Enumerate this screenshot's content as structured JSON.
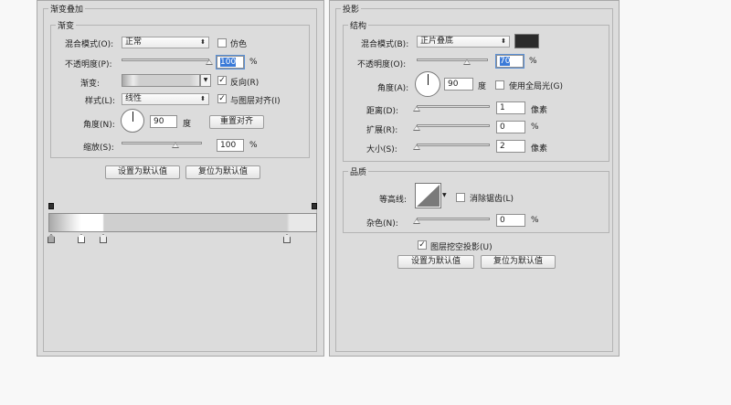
{
  "left_panel": {
    "title": "渐变叠加",
    "group_title": "渐变",
    "blend_mode": {
      "label": "混合模式(O):",
      "value": "正常"
    },
    "dither": {
      "label": "仿色",
      "checked": false
    },
    "opacity": {
      "label": "不透明度(P):",
      "value": "100",
      "unit": "%",
      "level": 100
    },
    "gradient": {
      "label": "渐变:"
    },
    "reverse": {
      "label": "反向(R)",
      "checked": true
    },
    "style": {
      "label": "样式(L):",
      "value": "线性"
    },
    "align_layer": {
      "label": "与图层对齐(I)",
      "checked": true
    },
    "angle": {
      "label": "角度(N):",
      "value": "90",
      "unit": "度"
    },
    "reset_align": "重置对齐",
    "scale": {
      "label": "缩放(S):",
      "value": "100",
      "unit": "%",
      "level": 67
    },
    "set_default": "设置为默认值",
    "reset_default": "复位为默认值",
    "gradient_colors": [
      "#a8a8a8",
      "#ececec",
      "#ffffff",
      "#cfcfcf",
      "#cfcfcf",
      "#e8e8e8"
    ]
  },
  "right_panel": {
    "title": "投影",
    "structure_title": "结构",
    "blend_mode": {
      "label": "混合模式(B):",
      "value": "正片叠底",
      "color": "#2b2b2b"
    },
    "opacity": {
      "label": "不透明度(O):",
      "value": "70",
      "unit": "%",
      "level": 70
    },
    "angle": {
      "label": "角度(A):",
      "value": "90",
      "unit": "度"
    },
    "global_light": {
      "label": "使用全局光(G)",
      "checked": false
    },
    "distance": {
      "label": "距离(D):",
      "value": "1",
      "unit": "像素"
    },
    "spread": {
      "label": "扩展(R):",
      "value": "0",
      "unit": "%"
    },
    "size": {
      "label": "大小(S):",
      "value": "2",
      "unit": "像素"
    },
    "quality_title": "品质",
    "contour": {
      "label": "等高线:"
    },
    "anti_alias": {
      "label": "消除锯齿(L)",
      "checked": false
    },
    "noise": {
      "label": "杂色(N):",
      "value": "0",
      "unit": "%"
    },
    "knockout": {
      "label": "图层挖空投影(U)",
      "checked": true
    },
    "set_default": "设置为默认值",
    "reset_default": "复位为默认值"
  }
}
